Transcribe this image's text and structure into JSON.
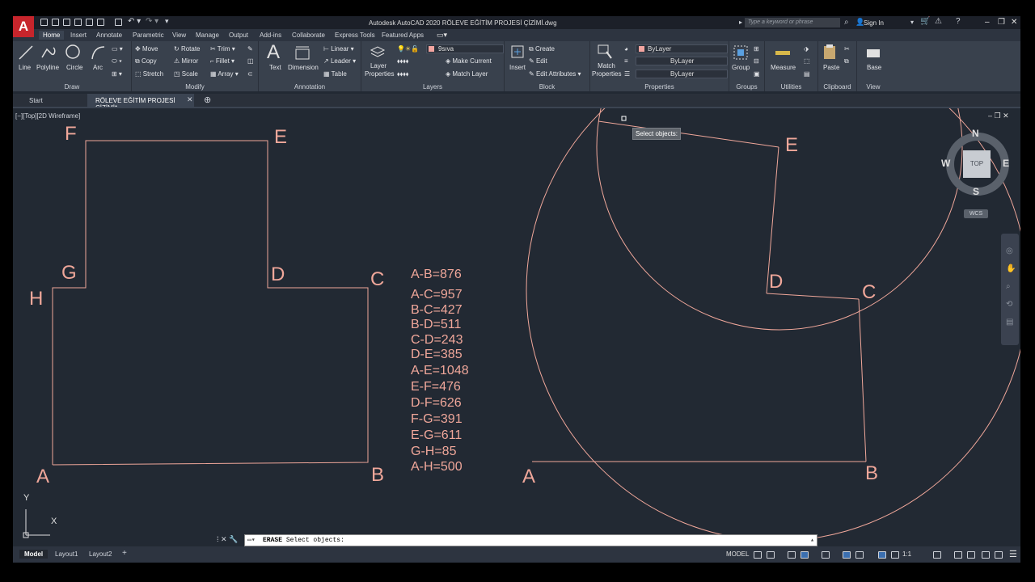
{
  "app": {
    "logo": "A",
    "title": "Autodesk AutoCAD 2020    RÖLEVE EĞİTİM PROJESİ ÇİZİMİ.dwg",
    "search_placeholder": "Type a keyword or phrase",
    "sign_in": "Sign In"
  },
  "ribbon_tabs": [
    "Home",
    "Insert",
    "Annotate",
    "Parametric",
    "View",
    "Manage",
    "Output",
    "Add-ins",
    "Collaborate",
    "Express Tools",
    "Featured Apps"
  ],
  "ribbon": {
    "draw": {
      "title": "Draw",
      "line": "Line",
      "polyline": "Polyline",
      "circle": "Circle",
      "arc": "Arc"
    },
    "modify": {
      "title": "Modify",
      "move": "Move",
      "rotate": "Rotate",
      "trim": "Trim",
      "copy": "Copy",
      "mirror": "Mirror",
      "fillet": "Fillet",
      "stretch": "Stretch",
      "scale": "Scale",
      "array": "Array"
    },
    "annotation": {
      "title": "Annotation",
      "text": "Text",
      "dimension": "Dimension",
      "linear": "Linear",
      "leader": "Leader",
      "table": "Table"
    },
    "layers": {
      "title": "Layers",
      "layer_properties": "Layer Properties",
      "current_layer": "9sıva",
      "make_current": "Make Current",
      "match_layer": "Match Layer"
    },
    "block": {
      "title": "Block",
      "insert": "Insert",
      "create": "Create",
      "edit": "Edit",
      "edit_attributes": "Edit Attributes"
    },
    "properties": {
      "title": "Properties",
      "match_properties": "Match Properties",
      "color": "ByLayer",
      "linetype": "ByLayer",
      "lineweight": "ByLayer"
    },
    "groups": {
      "title": "Groups",
      "group": "Group"
    },
    "utilities": {
      "title": "Utilities",
      "measure": "Measure"
    },
    "clipboard": {
      "title": "Clipboard",
      "paste": "Paste"
    },
    "view": {
      "title": "View",
      "base": "Base"
    }
  },
  "doc_tabs": {
    "start": "Start",
    "active": "RÖLEVE EĞİTİM PROJESİ ÇİZİMİ*"
  },
  "viewport": {
    "label": "[−][Top][2D Wireframe]",
    "tooltip": "Select objects:"
  },
  "left_drawing": {
    "points": {
      "F": "F",
      "E": "E",
      "G": "G",
      "D": "D",
      "C": "C",
      "H": "H",
      "A": "A",
      "B": "B"
    }
  },
  "right_drawing": {
    "points": {
      "E": "E",
      "D": "D",
      "C": "C",
      "A": "A",
      "B": "B"
    }
  },
  "measurements": [
    "A-B=876",
    "A-C=957",
    "B-C=427",
    "B-D=511",
    "C-D=243",
    "D-E=385",
    "A-E=1048",
    "E-F=476",
    "D-F=626",
    "F-G=391",
    "E-G=611",
    "G-H=85",
    "A-H=500"
  ],
  "viewcube": {
    "n": "N",
    "s": "S",
    "w": "W",
    "e": "E",
    "top": "TOP",
    "wcs": "WCS"
  },
  "ucs": {
    "x": "X",
    "y": "Y"
  },
  "command_line": {
    "command": "ERASE",
    "prompt": "Select objects:"
  },
  "layout_tabs": [
    "Model",
    "Layout1",
    "Layout2"
  ],
  "status": {
    "model": "MODEL",
    "scale": "1:1"
  },
  "colors": {
    "drawing": "#f0a79a",
    "background": "#222933",
    "ribbon": "#39414d"
  }
}
